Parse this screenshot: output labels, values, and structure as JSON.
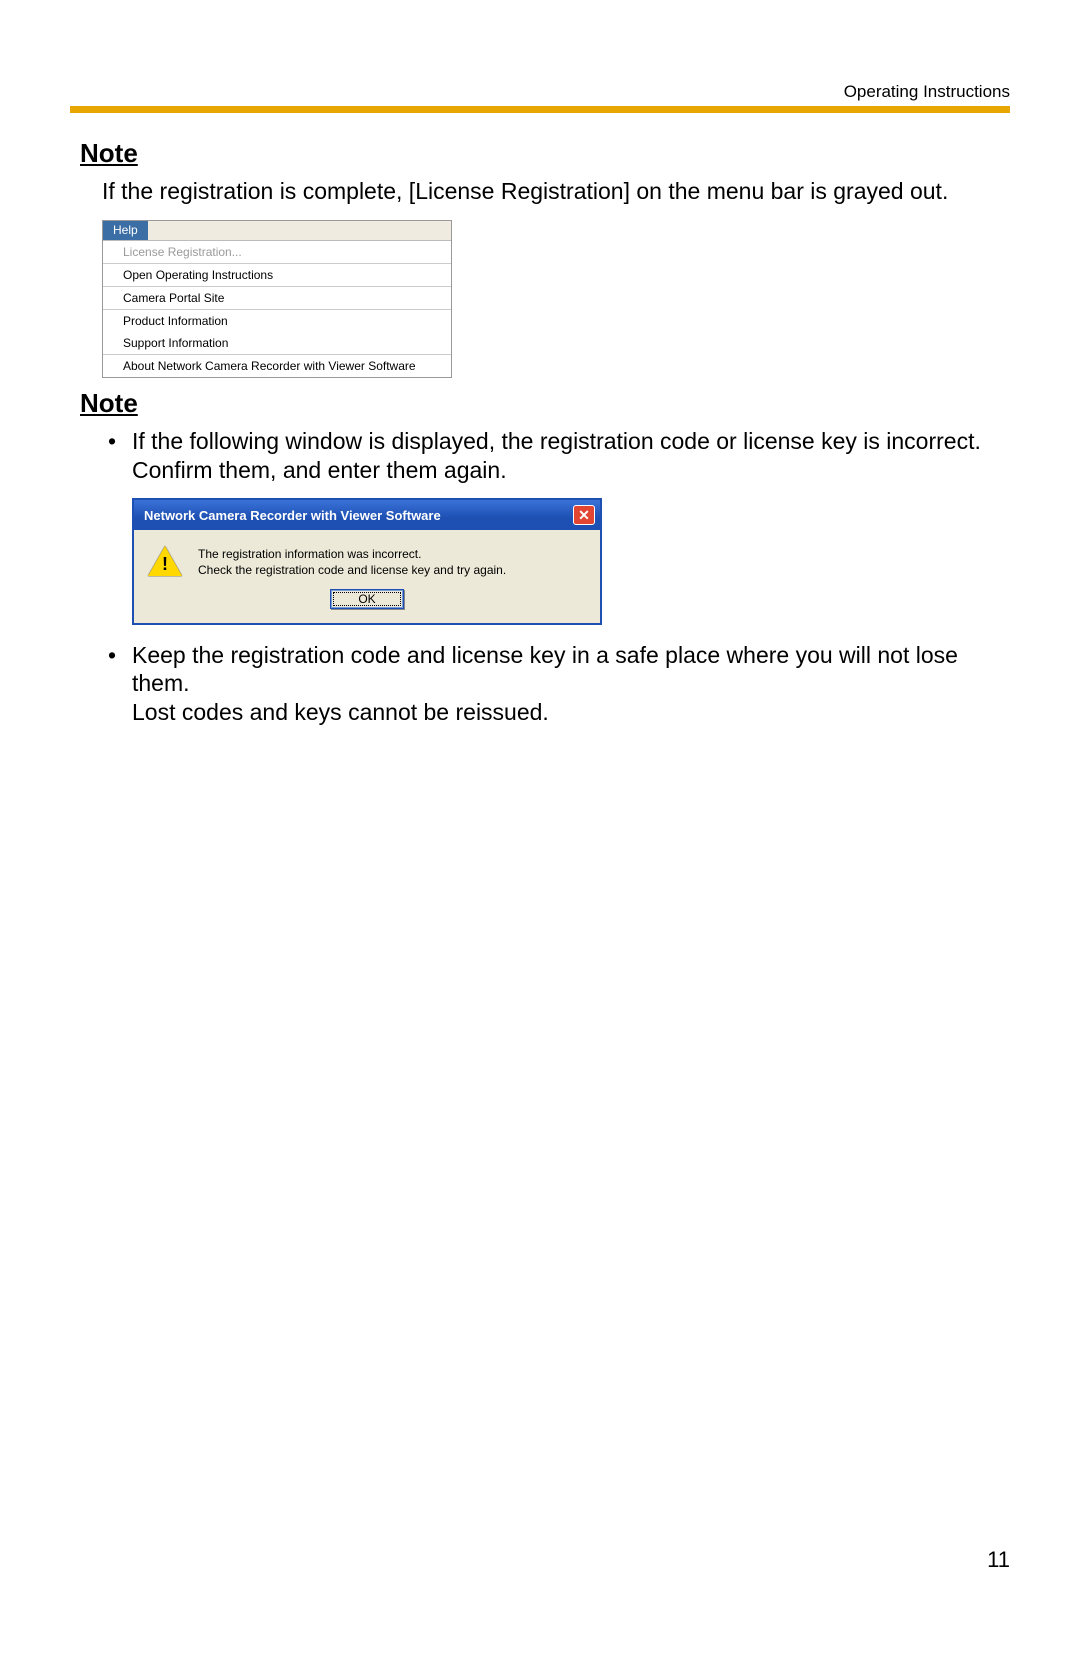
{
  "header": {
    "right": "Operating Instructions"
  },
  "note1": {
    "heading": "Note",
    "text": "If the registration is complete, [License Registration] on the menu bar is grayed out."
  },
  "help_menu": {
    "bar_label": "Help",
    "items": [
      {
        "label": "License Registration...",
        "disabled": true
      },
      {
        "label": "Open Operating Instructions",
        "disabled": false
      },
      {
        "label": "Camera Portal Site",
        "disabled": false
      },
      {
        "label": "Product Information",
        "disabled": false
      },
      {
        "label": "Support Information",
        "disabled": false
      },
      {
        "label": "About Network Camera Recorder with Viewer Software",
        "disabled": false
      }
    ]
  },
  "note2": {
    "heading": "Note",
    "bullet1": "If the following window is displayed, the registration code or license key is incorrect. Confirm them, and enter them again.",
    "bullet2_line1": "Keep the registration code and license key in a safe place where you will not lose them.",
    "bullet2_line2": "Lost codes and keys cannot be reissued."
  },
  "dialog": {
    "title": "Network Camera Recorder with Viewer Software",
    "close_glyph": "✕",
    "line1": "The registration information was incorrect.",
    "line2": "Check the registration code and license key and try again.",
    "ok_label": "OK",
    "warn_glyph": "!"
  },
  "page_number": "11"
}
